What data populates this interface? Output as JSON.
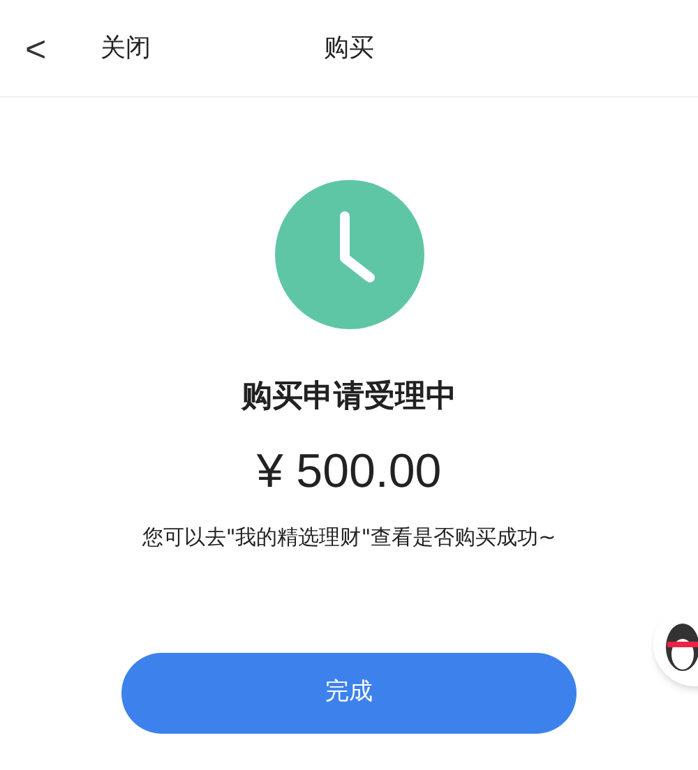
{
  "header": {
    "back": "<",
    "close": "关闭",
    "title": "购买"
  },
  "status": {
    "title": "购买申请受理中",
    "amount": "¥ 500.00",
    "message": "您可以去\"我的精选理财\"查看是否购买成功~"
  },
  "button": "完成"
}
